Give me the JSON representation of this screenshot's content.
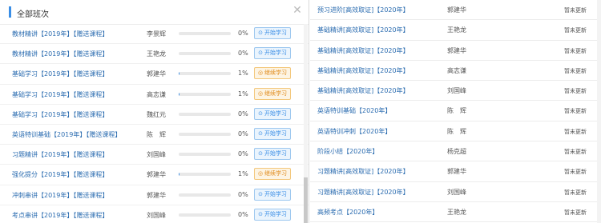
{
  "modal": {
    "title": "全部班次",
    "rows": [
      {
        "name": "教材精讲【2019年】【赠送课程】",
        "teacher": "李景辉",
        "progress": "0%",
        "progress_value": 0,
        "action": "开始学习",
        "action_type": "start"
      },
      {
        "name": "教材精讲【2019年】【赠送课程】",
        "teacher": "王艳龙",
        "progress": "0%",
        "progress_value": 0,
        "action": "开始学习",
        "action_type": "start"
      },
      {
        "name": "基础学习【2019年】【赠送课程】",
        "teacher": "郭建华",
        "progress": "1%",
        "progress_value": 1,
        "action": "继续学习",
        "action_type": "continue"
      },
      {
        "name": "基础学习【2019年】【赠送课程】",
        "teacher": "高志谦",
        "progress": "1%",
        "progress_value": 1,
        "action": "继续学习",
        "action_type": "continue"
      },
      {
        "name": "基础学习【2019年】【赠送课程】",
        "teacher": "魏红元",
        "progress": "0%",
        "progress_value": 0,
        "action": "开始学习",
        "action_type": "start"
      },
      {
        "name": "英语特训基础【2019年】【赠送课程】",
        "teacher": "陈　辉",
        "progress": "0%",
        "progress_value": 0,
        "action": "开始学习",
        "action_type": "start"
      },
      {
        "name": "习题精讲【2019年】【赠送课程】",
        "teacher": "刘国峰",
        "progress": "0%",
        "progress_value": 0,
        "action": "开始学习",
        "action_type": "start"
      },
      {
        "name": "强化提分【2019年】【赠送课程】",
        "teacher": "郭建华",
        "progress": "1%",
        "progress_value": 1,
        "action": "继续学习",
        "action_type": "continue"
      },
      {
        "name": "冲刺串讲【2019年】【赠送课程】",
        "teacher": "郭建华",
        "progress": "0%",
        "progress_value": 0,
        "action": "开始学习",
        "action_type": "start"
      },
      {
        "name": "考点串讲【2019年】【赠送课程】",
        "teacher": "刘国峰",
        "progress": "0%",
        "progress_value": 0,
        "action": "开始学习",
        "action_type": "start"
      }
    ]
  },
  "right": {
    "rows": [
      {
        "name": "预习进阶[高效取证]【2020年】",
        "teacher": "郭建华",
        "status": "暂未更新"
      },
      {
        "name": "基础精讲[高效取证]【2020年】",
        "teacher": "王艳龙",
        "status": "暂未更新"
      },
      {
        "name": "基础精讲[高效取证]【2020年】",
        "teacher": "郭建华",
        "status": "暂未更新"
      },
      {
        "name": "基础精讲[高效取证]【2020年】",
        "teacher": "高志谦",
        "status": "暂未更新"
      },
      {
        "name": "基础精讲[高效取证]【2020年】",
        "teacher": "刘国峰",
        "status": "暂未更新"
      },
      {
        "name": "英语特训基础【2020年】",
        "teacher": "陈　辉",
        "status": "暂未更新"
      },
      {
        "name": "英语特训冲刺【2020年】",
        "teacher": "陈　辉",
        "status": "暂未更新"
      },
      {
        "name": "阶段小结【2020年】",
        "teacher": "杨克超",
        "status": "暂未更新"
      },
      {
        "name": "习题精讲[高效取证]【2020年】",
        "teacher": "郭建华",
        "status": "暂未更新"
      },
      {
        "name": "习题精讲[高效取证]【2020年】",
        "teacher": "刘国峰",
        "status": "暂未更新"
      },
      {
        "name": "高频考点【2020年】",
        "teacher": "王艳龙",
        "status": "暂未更新"
      }
    ]
  },
  "colors": {
    "accent": "#3a8ee6",
    "continue": "#e08a1b"
  }
}
